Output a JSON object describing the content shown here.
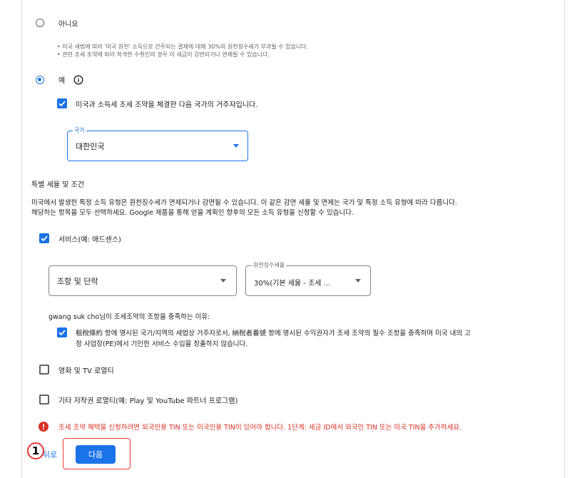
{
  "option_no": {
    "label": "아니요",
    "bullets": [
      "미국 세법에 따라 '미국 원천' 소득으로 간주되는 결제에 대해 30%의 원천징수세가 부과될 수 있습니다.",
      "관련 조세 조약에 따라 적격한 수취인의 경우 이 세금이 감면되거나 면제될 수 있습니다."
    ]
  },
  "option_yes": {
    "label": "예"
  },
  "treaty_checkbox_label": "미국과 소득세 조세 조약을 체결한 다음 국가의 거주자입니다.",
  "country_select": {
    "label": "국가",
    "value": "대한민국"
  },
  "special_rates": {
    "heading": "특별 세율 및 조건",
    "desc_line1": "미국에서 발생한 특정 소득 유형은 원천징수세가 면제되거나 감면될 수 있습니다. 이 같은 감면 세율 및 면제는 국가 및 특정 소득 유형에 따라 다릅니다.",
    "desc_line2": "해당하는 항목을 모두 선택하세요. Google 제품을 통해 얻을 계획인 향후의 모든 소득 유형을 신청할 수 있습니다."
  },
  "services": {
    "label": "서비스(예: 애드센스)",
    "article_select": {
      "value": "조항 및 단락"
    },
    "rate_select": {
      "label": "원천징수세율",
      "value": "30%(기본 세율 - 조세 ..."
    },
    "reason_heading": "gwang suk cho님이 조세조약의 조항을 충족하는 이유:",
    "reason_line1": "租稅條約 항에 명시된 국가/지역의 세법상 거주자로서, 納稅者番號 항에 명시된 수익권자가 조세 조약의 필수 조항을 충족하며 미국 내의 고",
    "reason_line2": "정 사업장(PE)에서 기인한 서비스 수입을 창출하지 않습니다."
  },
  "film_tv": {
    "label": "영화 및 TV 로열티"
  },
  "other_royalty": {
    "label": "기타 저작권 로열티(예: Play 및 YouTube 파트너 프로그램)"
  },
  "error": {
    "text": "조세 조약 혜택을 신청하려면 외국인용 TIN 또는 미국인용 TIN이 있어야 합니다. 1단계: 세금 ID에서 외국인 TIN 또는 미국 TIN을 추가하세요.",
    "color": "#d93025"
  },
  "footer": {
    "back_label": "뒤로",
    "next_label": "다음",
    "marker": "1"
  },
  "colors": {
    "accent": "#1a73e8",
    "annotation": "#e53935"
  }
}
